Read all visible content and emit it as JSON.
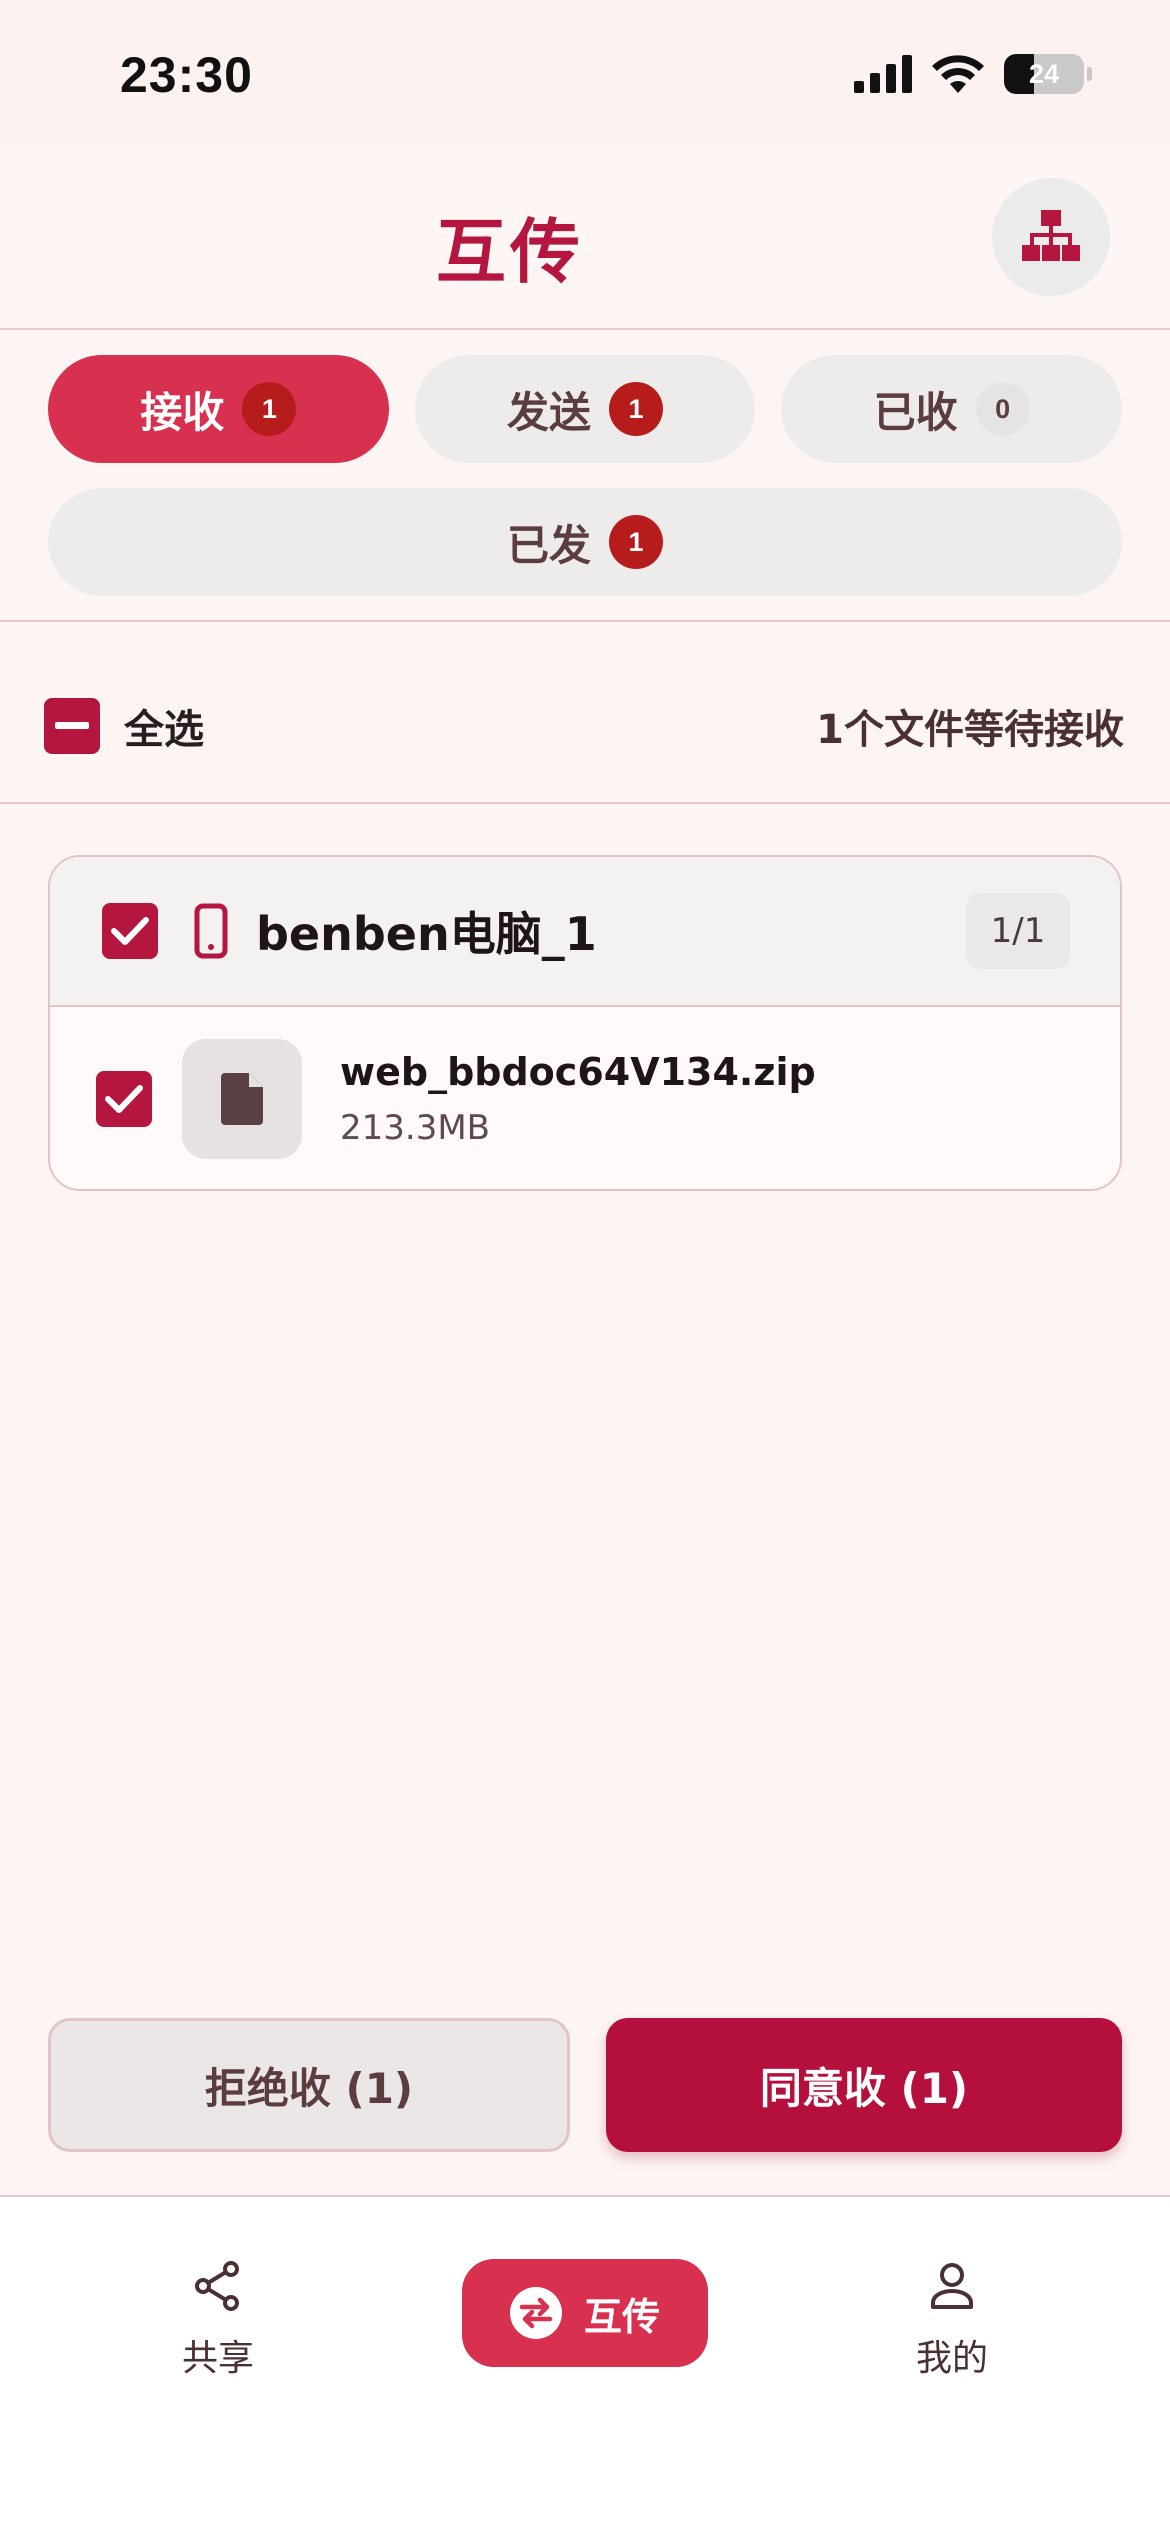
{
  "status_bar": {
    "time": "23:30",
    "battery": "24"
  },
  "header": {
    "title": "互传",
    "network_icon": "network-icon"
  },
  "tabs": [
    {
      "label": "接收",
      "count": "1",
      "active": true
    },
    {
      "label": "发送",
      "count": "1",
      "active": false
    },
    {
      "label": "已收",
      "count": "0",
      "active": false
    },
    {
      "label": "已发",
      "count": "1",
      "active": false
    }
  ],
  "selection": {
    "select_all_label": "全选",
    "pending_text": "1个文件等待接收"
  },
  "device_group": {
    "device_name": "benben电脑_1",
    "count": "1/1",
    "files": [
      {
        "name": "web_bbdoc64V134.zip",
        "size": "213.3MB"
      }
    ]
  },
  "actions": {
    "reject_label": "拒绝收 (1)",
    "accept_label": "同意收 (1)"
  },
  "bottom_nav": [
    {
      "label": "共享",
      "icon": "share-icon"
    },
    {
      "label": "互传",
      "icon": "swap-icon",
      "active": true
    },
    {
      "label": "我的",
      "icon": "user-icon"
    }
  ],
  "colors": {
    "accent": "#b5163f",
    "tab_active": "#d8304f",
    "badge": "#b71c1c"
  }
}
